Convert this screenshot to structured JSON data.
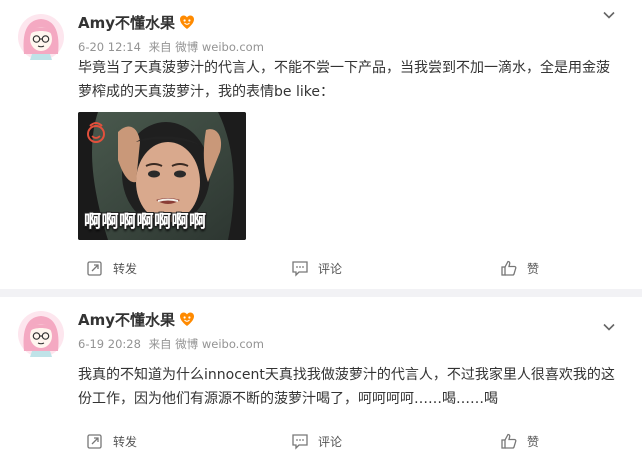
{
  "posts": [
    {
      "user": {
        "name": "Amy不懂水果"
      },
      "meta": {
        "time": "6-20 12:14",
        "source": "来自 微博 weibo.com"
      },
      "text_lines": [
        "毕竟当了天真菠萝汁的代言人，不能不尝一下产品，当我尝到不加一滴水，全是用金菠",
        "萝榨成的天真菠萝汁，我的表情be like："
      ],
      "media": {
        "caption": "啊啊啊啊啊啊啊"
      },
      "actions": {
        "repost": "转发",
        "comment": "评论",
        "like": "赞"
      }
    },
    {
      "user": {
        "name": "Amy不懂水果"
      },
      "meta": {
        "time": "6-19 20:28",
        "source": "来自 微博 weibo.com"
      },
      "text_lines": [
        "我真的不知道为什么innocent天真找我做菠萝汁的代言人，不过我家里人很喜欢我的这",
        "份工作，因为他们有源源不断的菠萝汁喝了，呵呵呵呵……喝……喝"
      ],
      "actions": {
        "repost": "转发",
        "comment": "评论",
        "like": "赞"
      }
    }
  ],
  "colors": {
    "background": "#f2f2f5",
    "card": "#ffffff",
    "username": "#333333",
    "meta": "#939393",
    "text": "#333333",
    "action_text": "#555555",
    "avatar_hair": "#f4a9c2"
  },
  "icons": [
    "avatar-illustration",
    "fan-badge-icon",
    "chevron-down-icon",
    "repost-icon",
    "comment-icon",
    "like-icon"
  ]
}
